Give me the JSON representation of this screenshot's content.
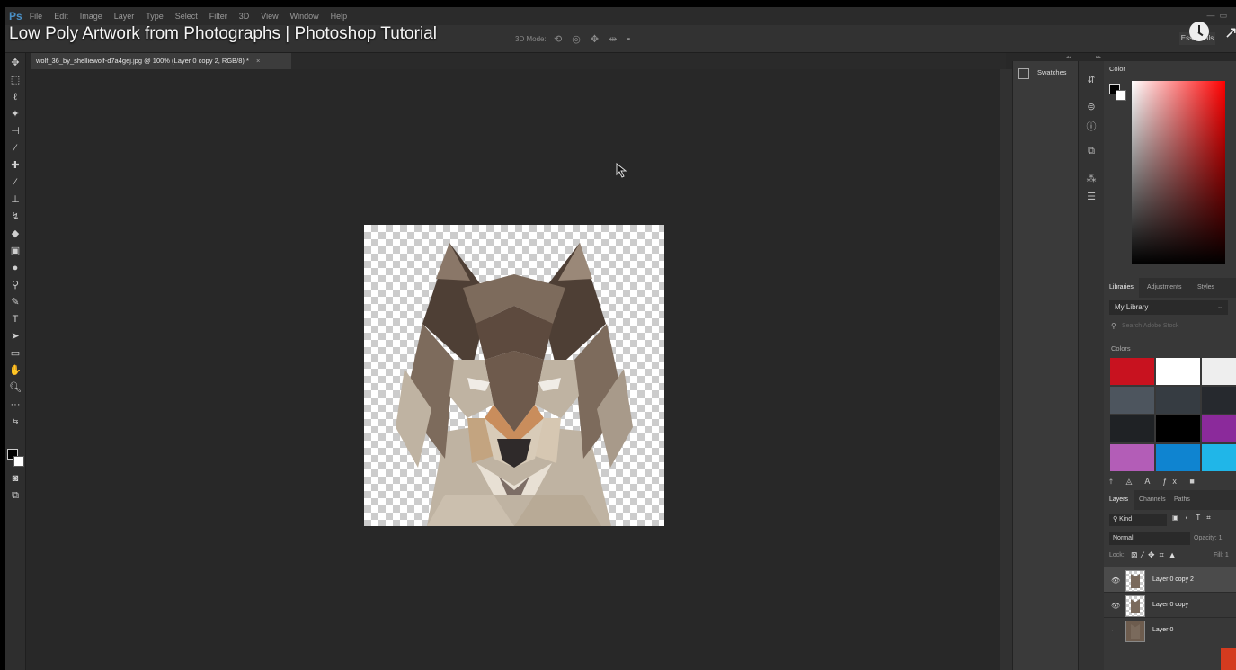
{
  "video": {
    "title": "Low Poly Artwork from Photographs | Photoshop Tutorial"
  },
  "menubar": {
    "logo": "Ps",
    "items": [
      "File",
      "Edit",
      "Image",
      "Layer",
      "Type",
      "Select",
      "Filter",
      "3D",
      "View",
      "Window",
      "Help"
    ]
  },
  "options": {
    "mode_3d": "3D Mode:",
    "workspace": "Essentials"
  },
  "document": {
    "tab_title": "wolf_36_by_shelliewolf-d7a4gej.jpg @ 100% (Layer 0 copy 2, RGB/8) *",
    "close": "×"
  },
  "swatches_panel": {
    "title": "Swatches"
  },
  "color_panel": {
    "title": "Color",
    "foreground": "#000000",
    "background": "#ffffff"
  },
  "libraries": {
    "tabs": [
      "Libraries",
      "Adjustments",
      "Styles"
    ],
    "library_name": "My Library",
    "search_placeholder": "Search Adobe Stock",
    "colors_label": "Colors",
    "colors": [
      "#c8121f",
      "#ffffff",
      "#eeeeee",
      "#4d555e",
      "#363c42",
      "#26292e",
      "#1f2225",
      "#000000",
      "#8b2a9b",
      "#b35db7",
      "#0f84d0",
      "#20b6e8"
    ]
  },
  "layers_panel": {
    "tabs": [
      "Layers",
      "Channels",
      "Paths"
    ],
    "kind_filter": "Kind",
    "blend_mode": "Normal",
    "opacity_label": "Opacity: 1",
    "lock_label": "Lock:",
    "fill_label": "Fill: 1",
    "layers": [
      {
        "name": "Layer 0 copy 2",
        "visible": true,
        "active": true
      },
      {
        "name": "Layer 0 copy",
        "visible": true,
        "active": false
      },
      {
        "name": "Layer 0",
        "visible": false,
        "active": false
      }
    ]
  },
  "wolf_palette": {
    "dark": "#4e3f35",
    "mid": "#7d6b5c",
    "light": "#bfb3a2",
    "tan": "#c3a480",
    "orange": "#c98d5c",
    "white": "#f0ece6",
    "nose": "#2f2a2a"
  }
}
